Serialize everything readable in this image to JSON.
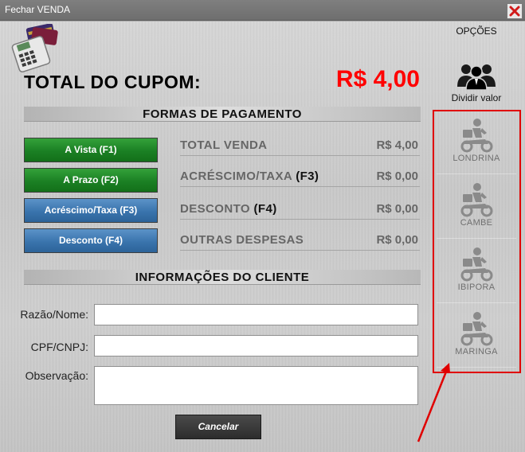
{
  "window": {
    "title": "Fechar VENDA"
  },
  "icons": {
    "close": "close-icon",
    "pos": "pos-terminal-icon",
    "people": "people-group-icon",
    "delivery": "delivery-scooter-icon"
  },
  "header": {
    "total_label": "TOTAL DO CUPOM:",
    "total_value": "R$ 4,00"
  },
  "payment": {
    "section_title": "FORMAS DE PAGAMENTO",
    "buttons": [
      {
        "label": "A Vista (F1)",
        "color": "#1b8024"
      },
      {
        "label": "A Prazo (F2)",
        "color": "#1b8024"
      },
      {
        "label": "Acréscimo/Taxa (F3)",
        "color": "#3a74ad"
      },
      {
        "label": "Desconto (F4)",
        "color": "#3a74ad"
      }
    ],
    "summary": [
      {
        "label": "TOTAL VENDA",
        "key": "",
        "value": "R$ 4,00"
      },
      {
        "label": "ACRÉSCIMO/TAXA",
        "key": "(F3)",
        "value": "R$ 0,00"
      },
      {
        "label": "DESCONTO",
        "key": "(F4)",
        "value": "R$ 0,00"
      },
      {
        "label": "OUTRAS DESPESAS",
        "key": "",
        "value": "R$ 0,00"
      }
    ]
  },
  "client": {
    "section_title": "INFORMAÇÕES DO CLIENTE",
    "fields": [
      {
        "label": "Razão/Nome:",
        "value": ""
      },
      {
        "label": "CPF/CNPJ:",
        "value": ""
      },
      {
        "label": "Observação:",
        "value": ""
      }
    ]
  },
  "actions": {
    "cancel_label": "Cancelar"
  },
  "sidebar": {
    "options_label": "OPÇÕES",
    "split_label": "Dividir valor",
    "highlight_color": "#e00000",
    "cities": [
      {
        "label": "LONDRINA"
      },
      {
        "label": "CAMBE"
      },
      {
        "label": "IBIPORA"
      },
      {
        "label": "MARINGA"
      }
    ]
  },
  "colors": {
    "total_value": "#ff0000",
    "annotation": "#e00000"
  }
}
